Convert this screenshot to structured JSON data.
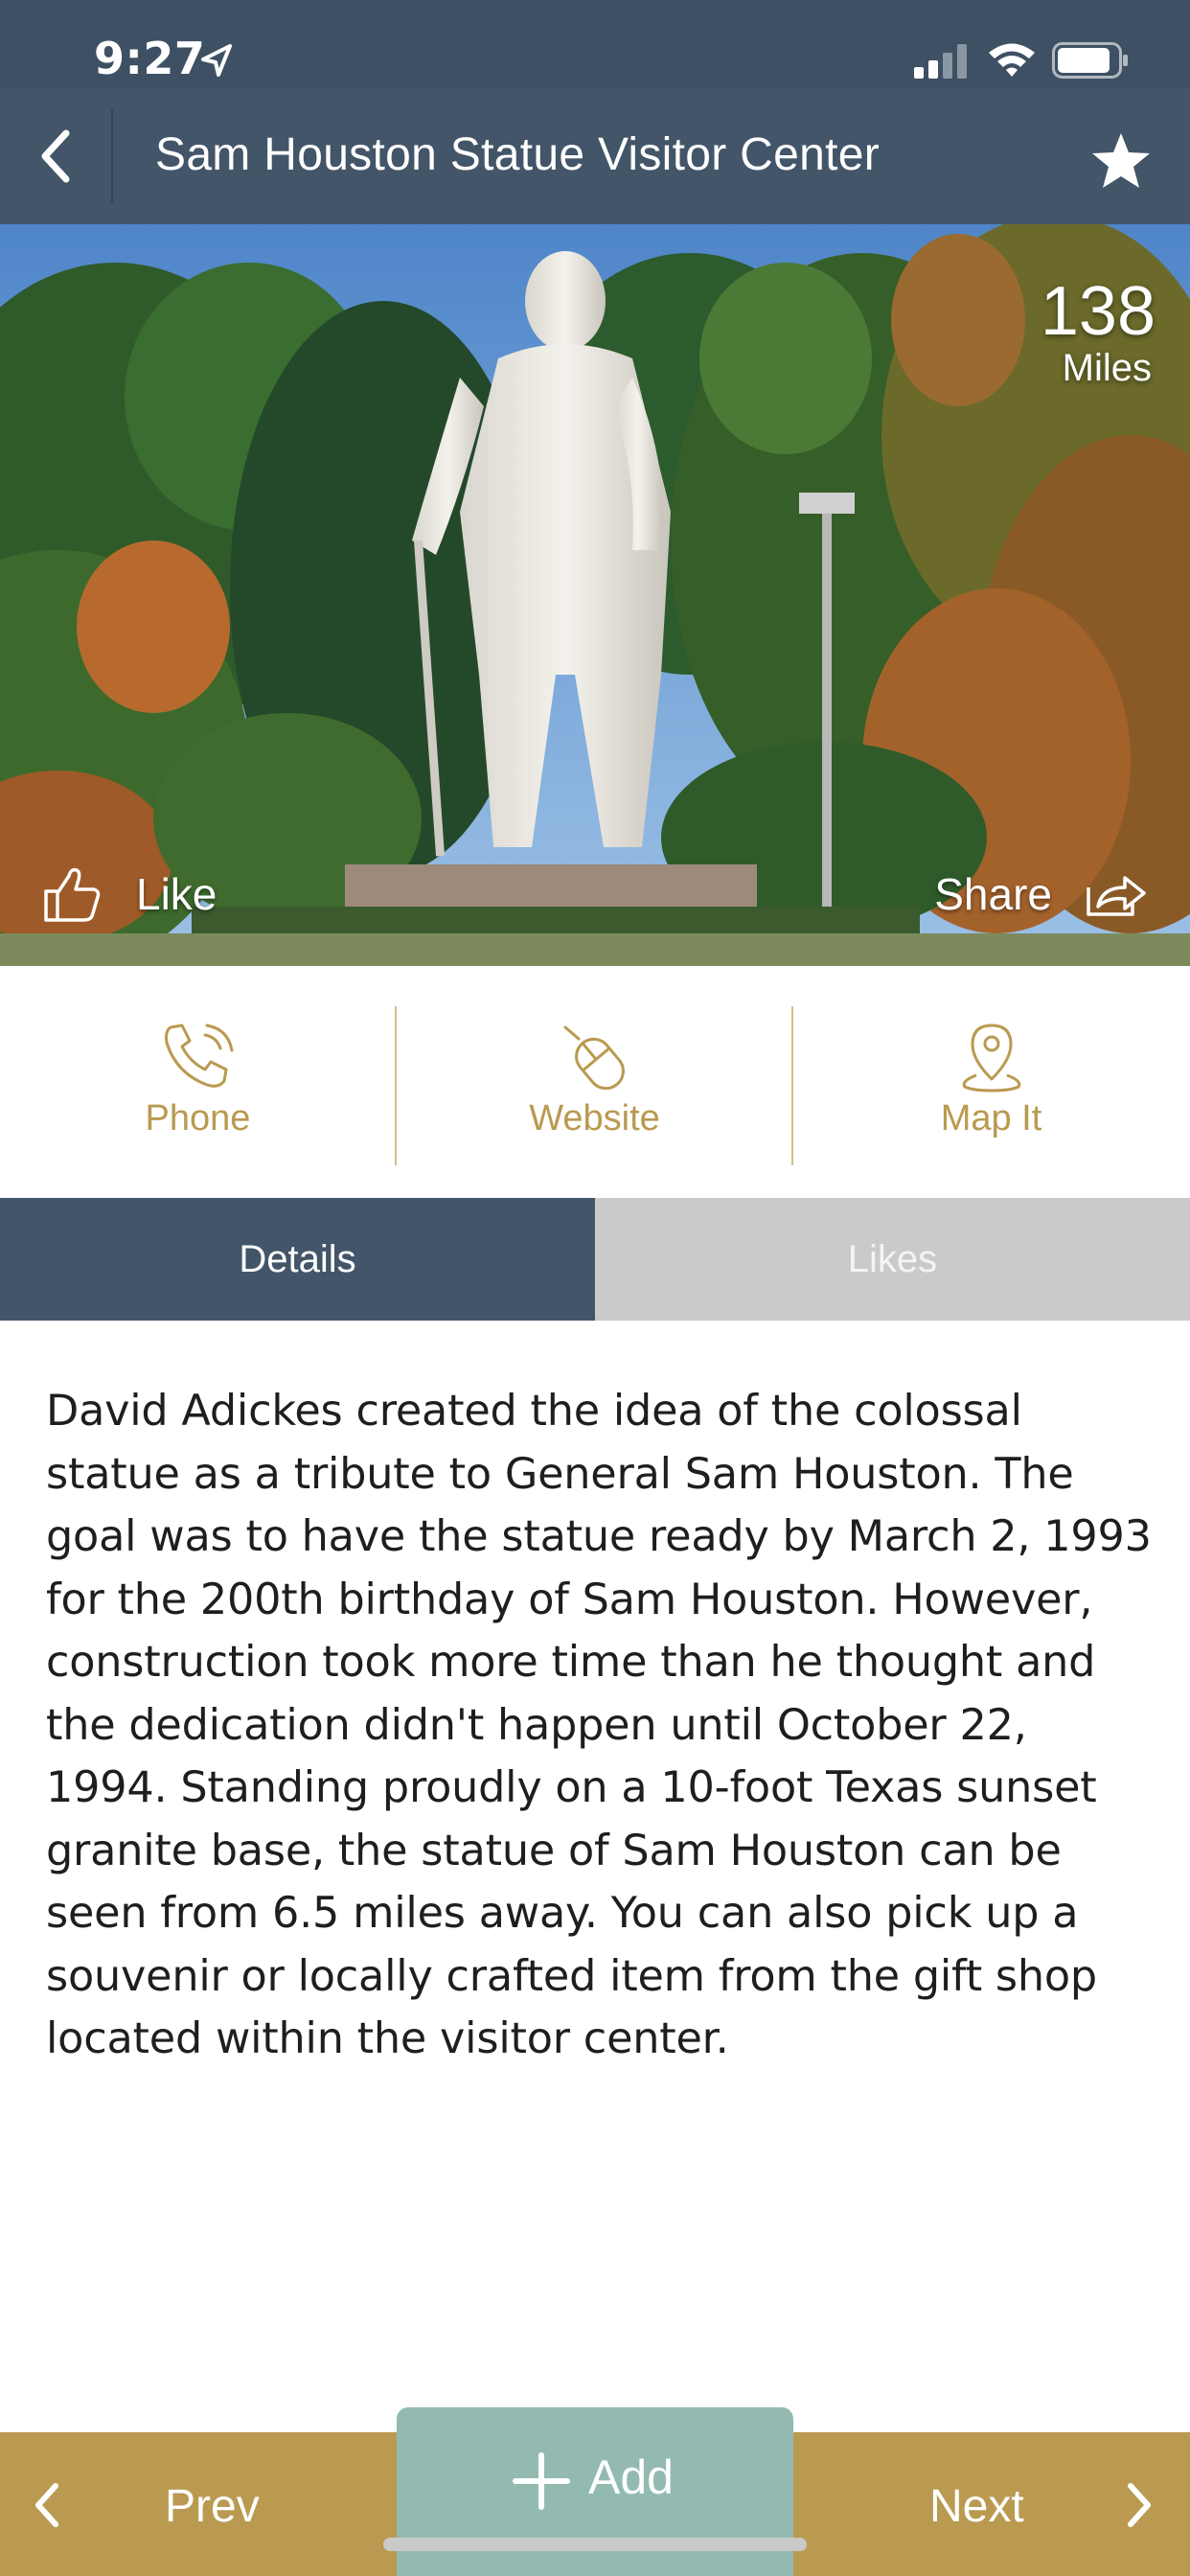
{
  "status_bar": {
    "time": "9:27",
    "location_icon": "location-arrow-icon",
    "signal_icon": "cellular-signal-icon",
    "wifi_icon": "wifi-icon",
    "battery_icon": "battery-icon"
  },
  "nav": {
    "back_icon": "chevron-left-icon",
    "title": "Sam Houston Statue Visitor Center",
    "favorite_icon": "star-icon"
  },
  "hero": {
    "distance_value": "138",
    "distance_unit": "Miles",
    "like_label": "Like",
    "like_icon": "thumbs-up-icon",
    "share_label": "Share",
    "share_icon": "share-icon"
  },
  "actions": [
    {
      "label": "Phone",
      "icon": "phone-icon"
    },
    {
      "label": "Website",
      "icon": "mouse-icon"
    },
    {
      "label": "Map It",
      "icon": "map-pin-icon"
    }
  ],
  "tabs": {
    "details": "Details",
    "likes": "Likes",
    "active": "Details"
  },
  "description": "David Adickes created the idea of the colossal statue as a tribute to General Sam Houston. The goal was to have the statue ready by March 2, 1993 for the 200th birthday of Sam Houston. However, construction took more time than he thought and the dedication didn't happen until October 22, 1994. Standing proudly on a 10-foot Texas sunset granite base, the statue of Sam Houston can be seen from 6.5 miles away. You can also pick up a souvenir or locally crafted item from the gift shop located within the visitor center.",
  "bottom_bar": {
    "prev_label": "Prev",
    "add_label": "Add",
    "next_label": "Next"
  },
  "colors": {
    "header": "#435568",
    "status_bar": "#3e5063",
    "accent_gold": "#b99a50",
    "add_teal": "#93bab1",
    "tab_inactive": "#cacaca"
  }
}
